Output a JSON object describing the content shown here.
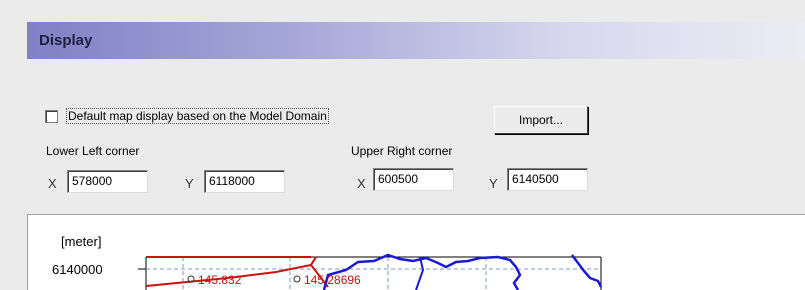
{
  "header": {
    "title": "Display"
  },
  "options": {
    "default_checkbox_label": "Default map display based on the Model Domain",
    "default_checked": false,
    "import_label": "Import..."
  },
  "lower_left": {
    "label": "Lower Left corner",
    "x_label": "X",
    "x_value": "578000",
    "y_label": "Y",
    "y_value": "6118000"
  },
  "upper_right": {
    "label": "Upper Right corner",
    "x_label": "X",
    "x_value": "600500",
    "y_label": "Y",
    "y_value": "6140500"
  },
  "plot": {
    "unit_label": "[meter]",
    "y_tick_label": "6140000",
    "annotations": [
      "145.832",
      "145.28696"
    ],
    "colors": {
      "boundary": "#cc1111",
      "network": "#1a1ad6",
      "grid": "#7799cc"
    }
  }
}
